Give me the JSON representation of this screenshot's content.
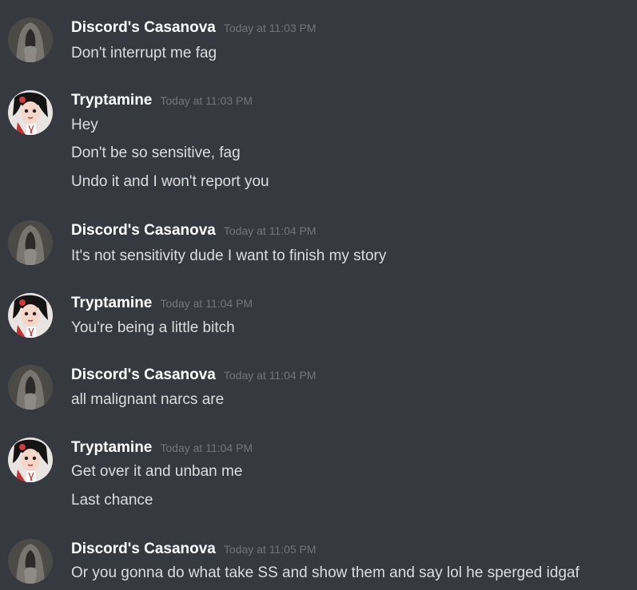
{
  "messages": [
    {
      "author": "Discord's Casanova",
      "avatar_icon": "grey-hooded-figure-avatar",
      "timestamp": "Today at 11:03 PM",
      "lines": [
        "Don't interrupt me fag"
      ]
    },
    {
      "author": "Tryptamine",
      "avatar_icon": "anime-girl-avatar",
      "timestamp": "Today at 11:03 PM",
      "lines": [
        "Hey",
        "Don't be so sensitive, fag",
        "Undo it and I won't report you"
      ]
    },
    {
      "author": "Discord's Casanova",
      "avatar_icon": "grey-hooded-figure-avatar",
      "timestamp": "Today at 11:04 PM",
      "lines": [
        "It's not sensitivity dude I want to finish my story"
      ]
    },
    {
      "author": "Tryptamine",
      "avatar_icon": "anime-girl-avatar",
      "timestamp": "Today at 11:04 PM",
      "lines": [
        "You're being a little bitch"
      ]
    },
    {
      "author": "Discord's Casanova",
      "avatar_icon": "grey-hooded-figure-avatar",
      "timestamp": "Today at 11:04 PM",
      "lines": [
        "all malignant narcs are"
      ]
    },
    {
      "author": "Tryptamine",
      "avatar_icon": "anime-girl-avatar",
      "timestamp": "Today at 11:04 PM",
      "lines": [
        "Get over it and unban me",
        "Last chance"
      ]
    },
    {
      "author": "Discord's Casanova",
      "avatar_icon": "grey-hooded-figure-avatar",
      "timestamp": "Today at 11:05 PM",
      "lines": [
        "Or you gonna do what take SS and show them and say lol he sperged idgaf"
      ]
    }
  ],
  "colors": {
    "background": "#36393f",
    "username": "#ffffff",
    "message_text": "#dcddde",
    "timestamp": "#72767d"
  }
}
